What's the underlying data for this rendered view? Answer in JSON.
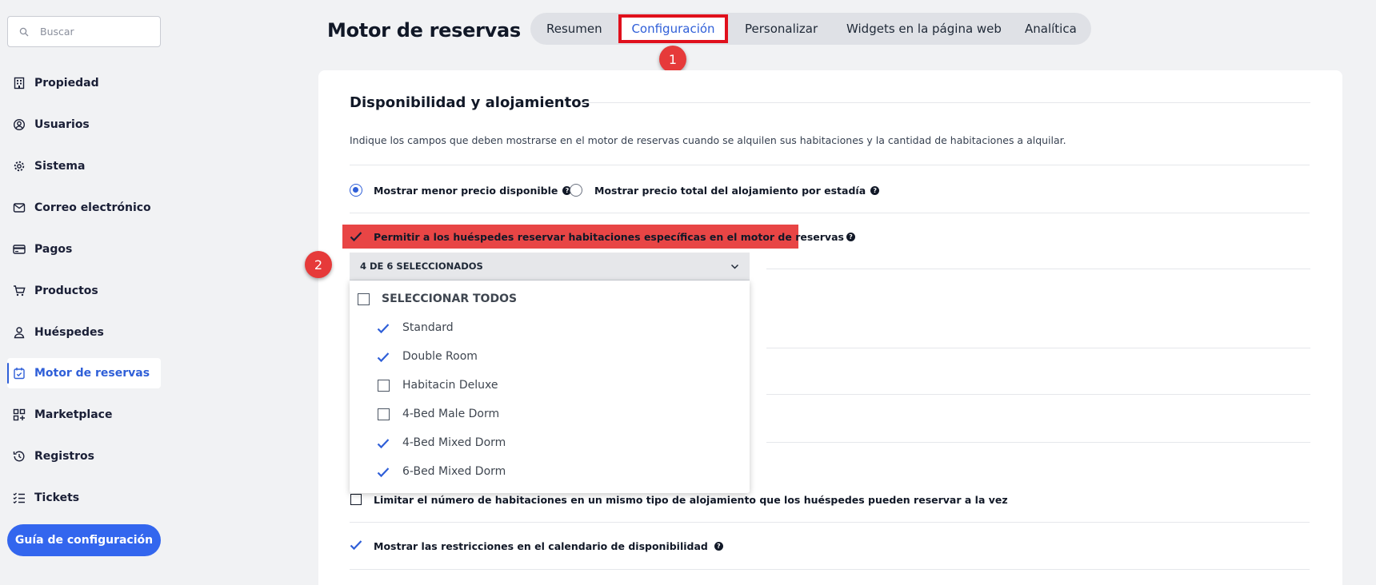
{
  "search": {
    "placeholder": "Buscar"
  },
  "sidebar": {
    "items": [
      {
        "label": "Propiedad",
        "icon": "building-icon"
      },
      {
        "label": "Usuarios",
        "icon": "user-circle-icon"
      },
      {
        "label": "Sistema",
        "icon": "gear-icon"
      },
      {
        "label": "Correo electrónico",
        "icon": "mail-icon"
      },
      {
        "label": "Pagos",
        "icon": "credit-card-icon"
      },
      {
        "label": "Productos",
        "icon": "cart-icon"
      },
      {
        "label": "Huéspedes",
        "icon": "person-icon"
      },
      {
        "label": "Motor de reservas",
        "icon": "calendar-check-icon",
        "active": true
      },
      {
        "label": "Marketplace",
        "icon": "grid-plus-icon"
      },
      {
        "label": "Registros",
        "icon": "history-icon"
      },
      {
        "label": "Tickets",
        "icon": "checklist-icon"
      }
    ],
    "guide_button": "Guía de configuración"
  },
  "header": {
    "title": "Motor de reservas",
    "tabs": [
      {
        "label": "Resumen"
      },
      {
        "label": "Configuración",
        "active": true
      },
      {
        "label": "Personalizar"
      },
      {
        "label": "Widgets en la página web"
      },
      {
        "label": "Analítica"
      }
    ]
  },
  "markers": {
    "one": "1",
    "two": "2"
  },
  "section": {
    "title": "Disponibilidad y alojamientos",
    "description": "Indique los campos que deben mostrarse en el motor de reservas cuando se alquilen sus habitaciones y la cantidad de habitaciones a alquilar.",
    "price_options": [
      {
        "label": "Mostrar menor precio disponible",
        "selected": true
      },
      {
        "label": "Mostrar precio total del alojamiento por estadía",
        "selected": false
      }
    ],
    "allow_specific_rooms": {
      "label": "Permitir a los huéspedes reservar habitaciones específicas en el motor de reservas",
      "checked": true
    },
    "room_select": {
      "summary": "4 DE 6 SELECCIONADOS",
      "select_all": "SELECCIONAR TODOS",
      "options": [
        {
          "label": "Standard",
          "checked": true
        },
        {
          "label": "Double Room",
          "checked": true
        },
        {
          "label": "Habitacin Deluxe",
          "checked": false
        },
        {
          "label": "4-Bed Male Dorm",
          "checked": false
        },
        {
          "label": "4-Bed Mixed Dorm",
          "checked": true
        },
        {
          "label": "6-Bed Mixed Dorm",
          "checked": true
        }
      ]
    },
    "limit_rooms": {
      "label": "Limitar el número de habitaciones en un mismo tipo de alojamiento que los huéspedes pueden reservar a la vez",
      "checked": false
    },
    "show_restrictions": {
      "label": "Mostrar las restricciones en el calendario de disponibilidad",
      "checked": true
    }
  },
  "colors": {
    "accent": "#3366ee",
    "highlight": "#e84545",
    "marker": "#e63a3a",
    "tab_outline": "#e0101c"
  }
}
